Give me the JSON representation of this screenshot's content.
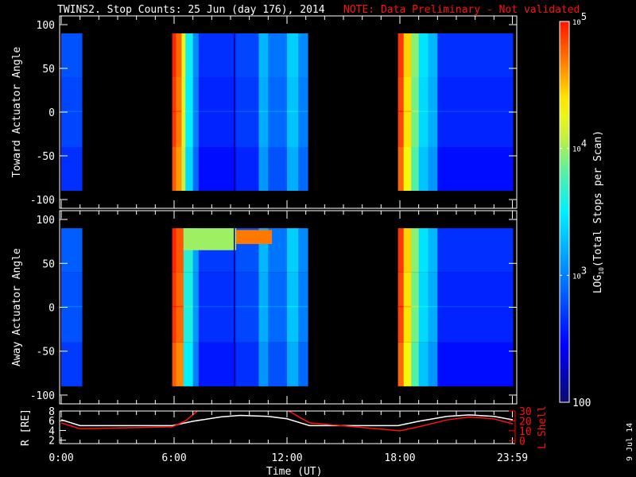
{
  "chart_data": {
    "type": "heatmap",
    "title": "TWINS2. Stop Counts: 25 Jun (day 176), 2014",
    "note": "NOTE: Data Preliminary - Not validated",
    "xlabel": "Time (UT)",
    "xlim_hours": [
      0,
      24
    ],
    "x_tick_labels": [
      {
        "h": 0,
        "label": "0:00"
      },
      {
        "h": 6,
        "label": "6:00"
      },
      {
        "h": 12,
        "label": "12:00"
      },
      {
        "h": 18,
        "label": "18:00"
      },
      {
        "h": 23.98,
        "label": "23:59"
      }
    ],
    "stamp": "9 Jul 14",
    "colorbar": {
      "label": "LOG10(Total Stops per Scan)",
      "label_main": "LOG",
      "label_sub": "10",
      "label_rest": "(Total Stops per Scan)",
      "range_log10": [
        2,
        5
      ],
      "ticks": [
        {
          "v": 5,
          "label": "10",
          "exp": "5"
        },
        {
          "v": 4,
          "label": "10",
          "exp": "4"
        },
        {
          "v": 3,
          "label": "10",
          "exp": "3"
        },
        {
          "v": 2,
          "label": "100",
          "exp": ""
        }
      ]
    },
    "panels": [
      {
        "ylabel": "Toward Actuator Angle",
        "ylim": [
          -110,
          110
        ],
        "data_range": [
          -90,
          90
        ],
        "y_ticks": [
          100,
          50,
          0,
          -50,
          -100
        ],
        "columns_log10": [
          [
            0,
            1.1,
            2.75
          ],
          [
            5.9,
            6.1,
            4.9
          ],
          [
            6.1,
            6.4,
            4.7
          ],
          [
            6.4,
            6.6,
            4.2
          ],
          [
            6.6,
            7.0,
            3.5
          ],
          [
            7.0,
            7.3,
            3.0
          ],
          [
            7.3,
            9.3,
            2.6
          ],
          [
            9.3,
            10.5,
            2.7
          ],
          [
            10.5,
            11.0,
            3.2
          ],
          [
            11.0,
            12.0,
            2.9
          ],
          [
            12.0,
            12.6,
            3.3
          ],
          [
            12.6,
            13.1,
            3.0
          ],
          [
            17.9,
            18.2,
            4.85
          ],
          [
            18.2,
            18.6,
            4.4
          ],
          [
            18.6,
            19.0,
            3.9
          ],
          [
            19.0,
            19.5,
            3.4
          ],
          [
            19.5,
            20.0,
            3.2
          ],
          [
            20.0,
            24.0,
            2.6
          ]
        ],
        "features": []
      },
      {
        "ylabel": "Away Actuator Angle",
        "ylim": [
          -110,
          110
        ],
        "data_range": [
          -90,
          90
        ],
        "y_ticks": [
          100,
          50,
          0,
          -50,
          -100
        ],
        "columns_log10": [
          [
            0,
            1.1,
            2.8
          ],
          [
            5.9,
            6.1,
            4.9
          ],
          [
            6.1,
            6.5,
            4.75
          ],
          [
            6.5,
            7.0,
            3.6
          ],
          [
            7.0,
            7.3,
            3.1
          ],
          [
            7.3,
            9.3,
            2.65
          ],
          [
            9.3,
            10.5,
            2.75
          ],
          [
            10.5,
            11.0,
            3.2
          ],
          [
            11.0,
            12.0,
            2.9
          ],
          [
            12.0,
            12.6,
            3.3
          ],
          [
            12.6,
            13.1,
            3.0
          ],
          [
            17.9,
            18.2,
            4.85
          ],
          [
            18.2,
            18.6,
            4.4
          ],
          [
            18.6,
            19.0,
            3.9
          ],
          [
            19.0,
            19.5,
            3.4
          ],
          [
            19.5,
            20.0,
            3.2
          ],
          [
            20.0,
            24.0,
            2.6
          ]
        ],
        "features": [
          {
            "t0": 6.5,
            "t1": 9.3,
            "a0": 65,
            "a1": 90,
            "v": 4.0
          },
          {
            "t0": 9.3,
            "t1": 11.2,
            "a0": 72,
            "a1": 88,
            "v": 4.7
          }
        ]
      }
    ],
    "ephemeris": {
      "left_label": "R [RE]",
      "right_label": "L Shell",
      "left_ylim": [
        1.3,
        8
      ],
      "right_ylim": [
        -3,
        30
      ],
      "left_ticks": [
        8,
        6,
        4,
        2
      ],
      "right_ticks": [
        30,
        20,
        10,
        0
      ],
      "series": [
        {
          "name": "R",
          "color": "#ffffff",
          "axis": "left",
          "points": [
            [
              0,
              6.2
            ],
            [
              1,
              5
            ],
            [
              5.9,
              5
            ],
            [
              7,
              5.9
            ],
            [
              8.5,
              6.8
            ],
            [
              9.5,
              7.1
            ],
            [
              11,
              6.9
            ],
            [
              12,
              6.4
            ],
            [
              13.2,
              5
            ],
            [
              17.9,
              5
            ],
            [
              19,
              5.9
            ],
            [
              20.5,
              6.9
            ],
            [
              21.7,
              7.2
            ],
            [
              23,
              6.9
            ],
            [
              24,
              6.2
            ]
          ]
        },
        {
          "name": "L Shell",
          "color": "#ff1010",
          "axis": "right",
          "points": [
            [
              0,
              18
            ],
            [
              1,
              12
            ],
            [
              5.9,
              14
            ],
            [
              6.6,
              20
            ],
            [
              7.3,
              31
            ],
            [
              12,
              31
            ],
            [
              13.2,
              18
            ],
            [
              18,
              10
            ],
            [
              19,
              14
            ],
            [
              20.5,
              21
            ],
            [
              21.7,
              24
            ],
            [
              23,
              22
            ],
            [
              24,
              17
            ]
          ]
        }
      ]
    }
  }
}
